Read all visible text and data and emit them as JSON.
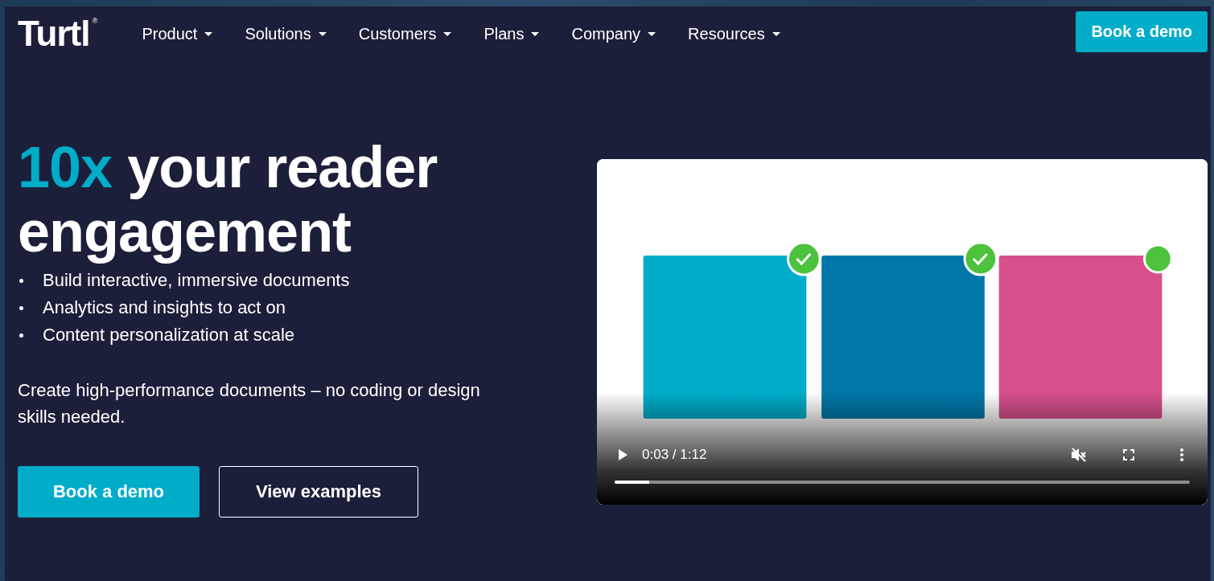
{
  "header": {
    "logo": "Turtl",
    "logo_mark": "®",
    "nav": [
      {
        "label": "Product",
        "dropdown": true
      },
      {
        "label": "Solutions",
        "dropdown": true
      },
      {
        "label": "Customers",
        "dropdown": true
      },
      {
        "label": "Plans",
        "dropdown": true
      },
      {
        "label": "Company",
        "dropdown": true
      },
      {
        "label": "Resources",
        "dropdown": true
      }
    ],
    "cta": "Book a demo"
  },
  "hero": {
    "heading": "**10x** your reader engagement",
    "bullets": [
      "Build interactive, immersive documents",
      "Analytics and insights to act on",
      "Content personalization at scale"
    ],
    "description": "Create high-performance documents – no coding or design skills needed.",
    "buttons": [
      {
        "label": "Book a demo",
        "kind": "primary"
      },
      {
        "label": "View examples",
        "kind": "outline"
      }
    ]
  },
  "video": {
    "playing": false,
    "time": "0:03 / 1:12",
    "muted": true,
    "level": 0.06
  }
}
